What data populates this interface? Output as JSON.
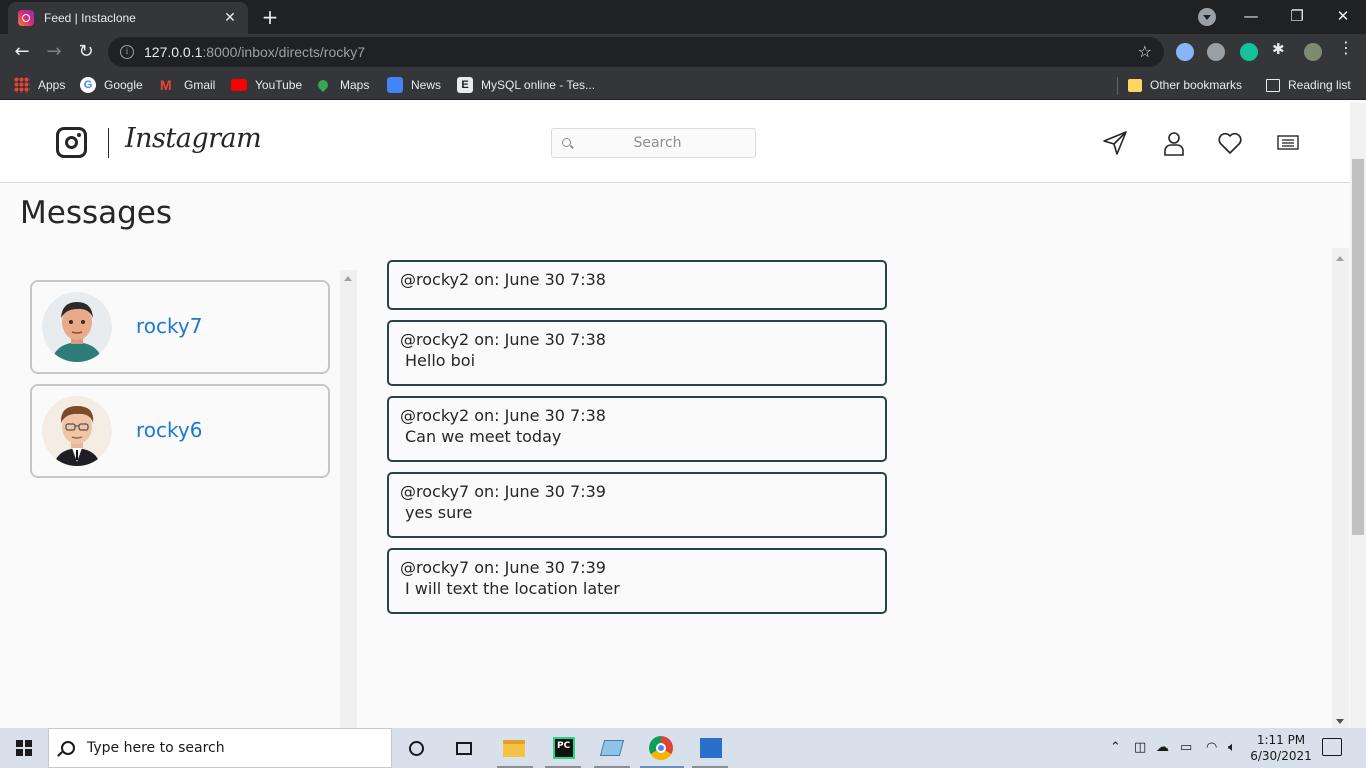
{
  "browser": {
    "tab_title": "Feed | Instaclone",
    "url_host": "127.0.0.1",
    "url_rest": ":8000/inbox/directs/rocky7",
    "bookmarks": [
      "Apps",
      "Google",
      "Gmail",
      "YouTube",
      "Maps",
      "News",
      "MySQL online - Tes..."
    ],
    "other_bookmarks": "Other bookmarks",
    "reading_list": "Reading list"
  },
  "header": {
    "brand": "Instagram",
    "search_placeholder": "Search"
  },
  "page_title": "Messages",
  "contacts": [
    {
      "name": "rocky7",
      "avatar": "avatar-dark-hair"
    },
    {
      "name": "rocky6",
      "avatar": "avatar-glasses-suit"
    }
  ],
  "messages": [
    {
      "meta": "@rocky2 on: June 30 7:38",
      "body": ""
    },
    {
      "meta": "@rocky2 on: June 30 7:38",
      "body": "Hello boi"
    },
    {
      "meta": "@rocky2 on: June 30 7:38",
      "body": "Can we meet today"
    },
    {
      "meta": "@rocky7 on: June 30 7:39",
      "body": "yes sure"
    },
    {
      "meta": "@rocky7 on: June 30 7:39",
      "body": "I will text the location later"
    }
  ],
  "taskbar": {
    "search_placeholder": "Type here to search",
    "time": "1:11 PM",
    "date": "6/30/2021"
  },
  "colors": {
    "link": "#1d79d0",
    "message_border": "#2b4346",
    "contact_border": "#c7c7c7"
  }
}
